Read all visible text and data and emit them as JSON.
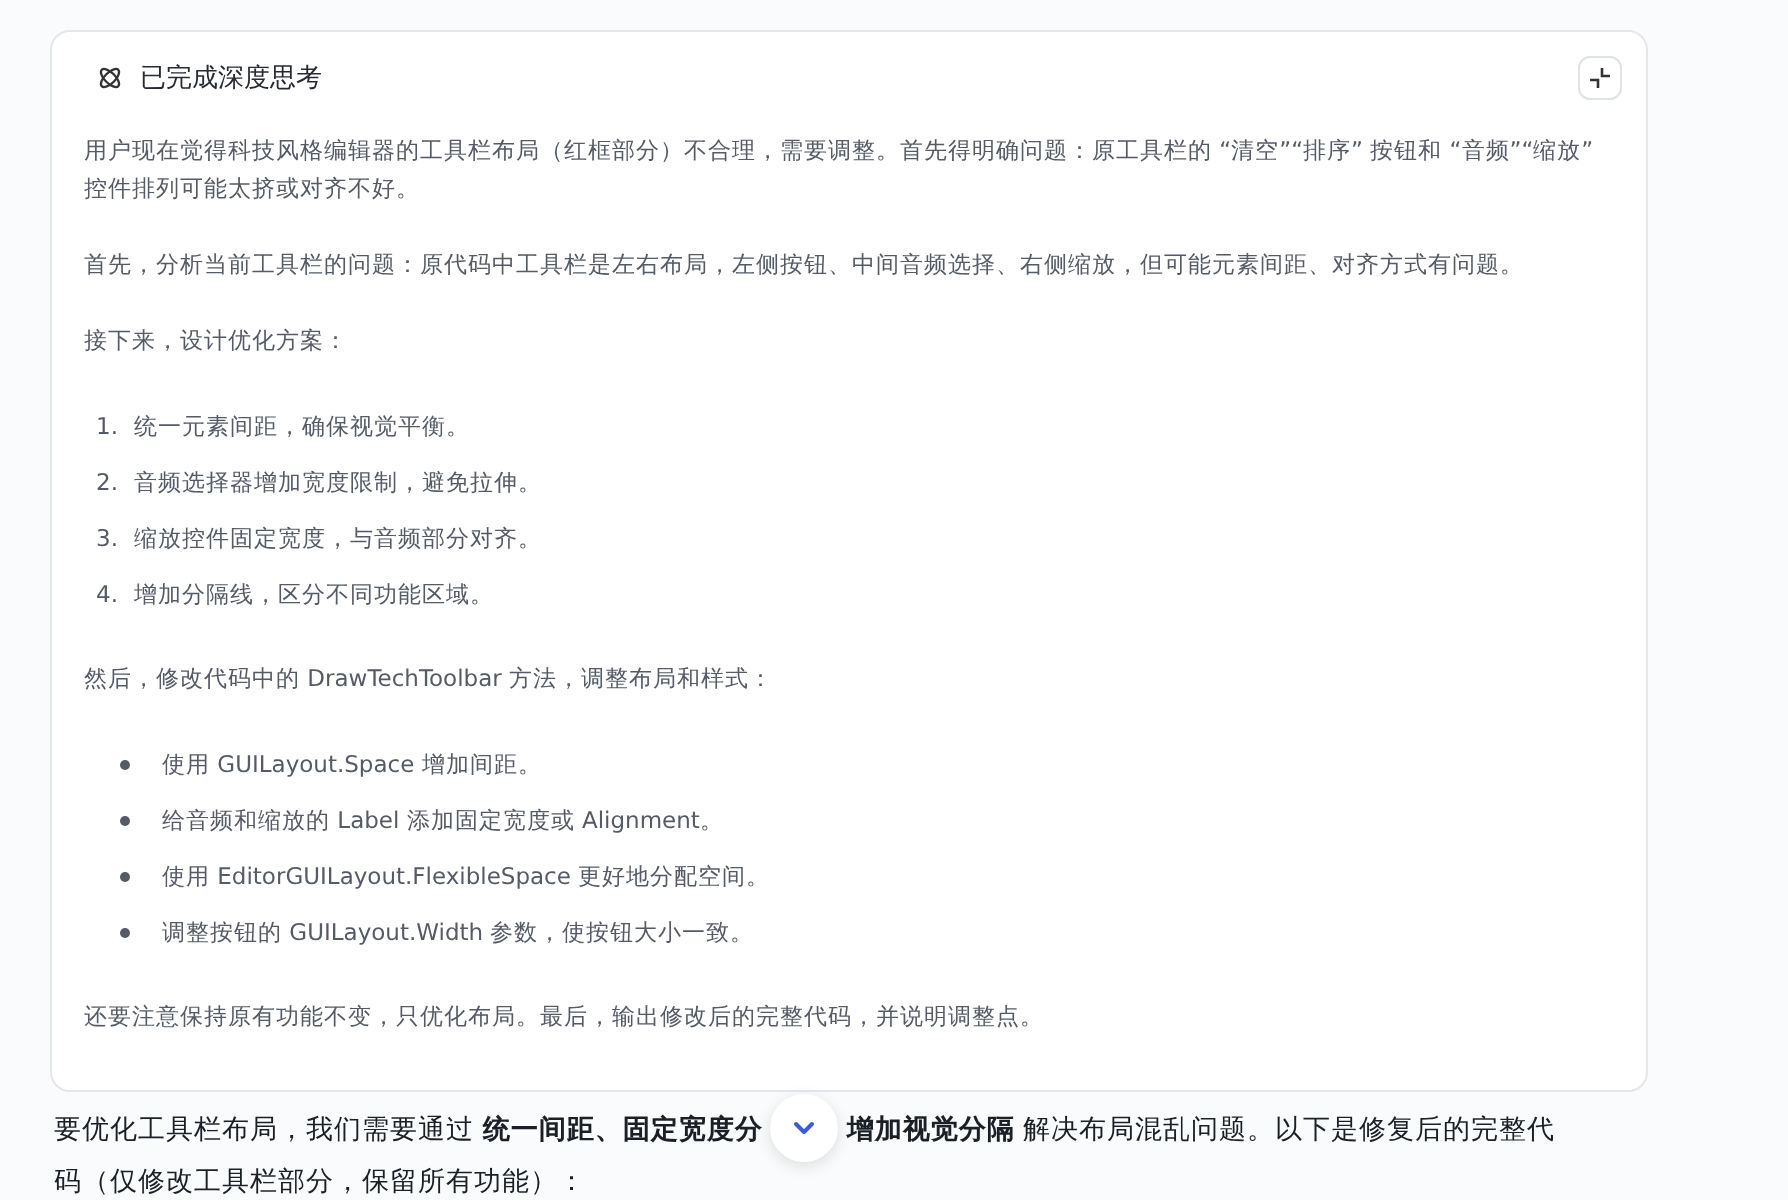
{
  "thinking": {
    "title": "已完成深度思考",
    "expanded": true,
    "blocks": [
      {
        "kind": "paragraph",
        "text": "用户现在觉得科技风格编辑器的工具栏布局（红框部分）不合理，需要调整。首先得明确问题：原工具栏的 “清空”“排序” 按钮和 “音频”“缩放” 控件排列可能太挤或对齐不好。"
      },
      {
        "kind": "paragraph",
        "text": "首先，分析当前工具栏的问题：原代码中工具栏是左右布局，左侧按钮、中间音频选择、右侧缩放，但可能元素间距、对齐方式有问题。"
      },
      {
        "kind": "paragraph",
        "text": "接下来，设计优化方案："
      },
      {
        "kind": "ordered",
        "items": [
          {
            "number": "1.",
            "text": "统一元素间距，确保视觉平衡。"
          },
          {
            "number": "2.",
            "text": "音频选择器增加宽度限制，避免拉伸。"
          },
          {
            "number": "3.",
            "text": "缩放控件固定宽度，与音频部分对齐。"
          },
          {
            "number": "4.",
            "text": "增加分隔线，区分不同功能区域。"
          }
        ]
      },
      {
        "kind": "paragraph",
        "text": "然后，修改代码中的 DrawTechToolbar 方法，调整布局和样式："
      },
      {
        "kind": "bullets",
        "items": [
          "使用 GUILayout.Space 增加间距。",
          "给音频和缩放的 Label 添加固定宽度或 Alignment。",
          "使用 EditorGUILayout.FlexibleSpace 更好地分配空间。",
          "调整按钮的 GUILayout.Width 参数，使按钮大小一致。"
        ]
      },
      {
        "kind": "paragraph",
        "text": "还要注意保持原有功能不变，只优化布局。最后，输出修改后的完整代码，并说明调整点。"
      }
    ]
  },
  "answer": {
    "before": "要优化工具栏布局，我们需要通过 **统一间距、固定宽度分**",
    "after": "**增加视觉分隔** 解决布局混乱问题。以下是修复后的完整代",
    "continuation": "码（仅修改工具栏部分，保留所有功能）："
  }
}
